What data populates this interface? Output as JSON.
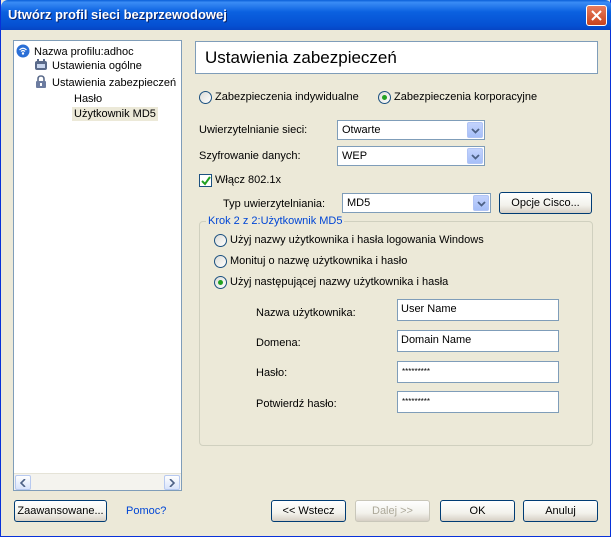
{
  "window": {
    "title": "Utwórz profil sieci bezprzewodowej"
  },
  "tree": {
    "items": [
      {
        "label": "Nazwa profilu:adhoc",
        "icon": "network-profile-icon"
      },
      {
        "label": "Ustawienia ogólne",
        "icon": "general-settings-icon"
      },
      {
        "label": "Ustawienia zabezpieczeń",
        "icon": "lock-icon"
      },
      {
        "label": "Hasło"
      },
      {
        "label": "Użytkownik MD5"
      }
    ]
  },
  "panel": {
    "title": "Ustawienia zabezpieczeń",
    "security_mode": {
      "individual": "Zabezpieczenia indywidualne",
      "corporate": "Zabezpieczenia korporacyjne",
      "selected": "corporate"
    },
    "network_auth": {
      "label": "Uwierzytelnianie sieci:",
      "value": "Otwarte"
    },
    "encryption": {
      "label": "Szyfrowanie danych:",
      "value": "WEP"
    },
    "enable_8021x": {
      "label": "Włącz 802.1x",
      "checked": true
    },
    "auth_type": {
      "label": "Typ uwierzytelniania:",
      "value": "MD5"
    },
    "cisco_button": "Opcje Cisco...",
    "group": {
      "legend": "Krok 2 z 2:Użytkownik MD5",
      "opt_windows": "Użyj nazwy użytkownika i hasła logowania Windows",
      "opt_prompt": "Monituj o nazwę użytkownika i hasło",
      "opt_following": "Użyj następującej nazwy użytkownika i hasła",
      "selected": "following",
      "username": {
        "label": "Nazwa użytkownika:",
        "value": "User Name"
      },
      "domain": {
        "label": "Domena:",
        "value": "Domain Name"
      },
      "password": {
        "label": "Hasło:",
        "value": "*********"
      },
      "confirm": {
        "label": "Potwierdź hasło:",
        "value": "*********"
      }
    }
  },
  "footer": {
    "advanced": "Zaawansowane...",
    "help": "Pomoc?",
    "back": "<< Wstecz",
    "next": "Dalej >>",
    "ok": "OK",
    "cancel": "Anuluj"
  }
}
